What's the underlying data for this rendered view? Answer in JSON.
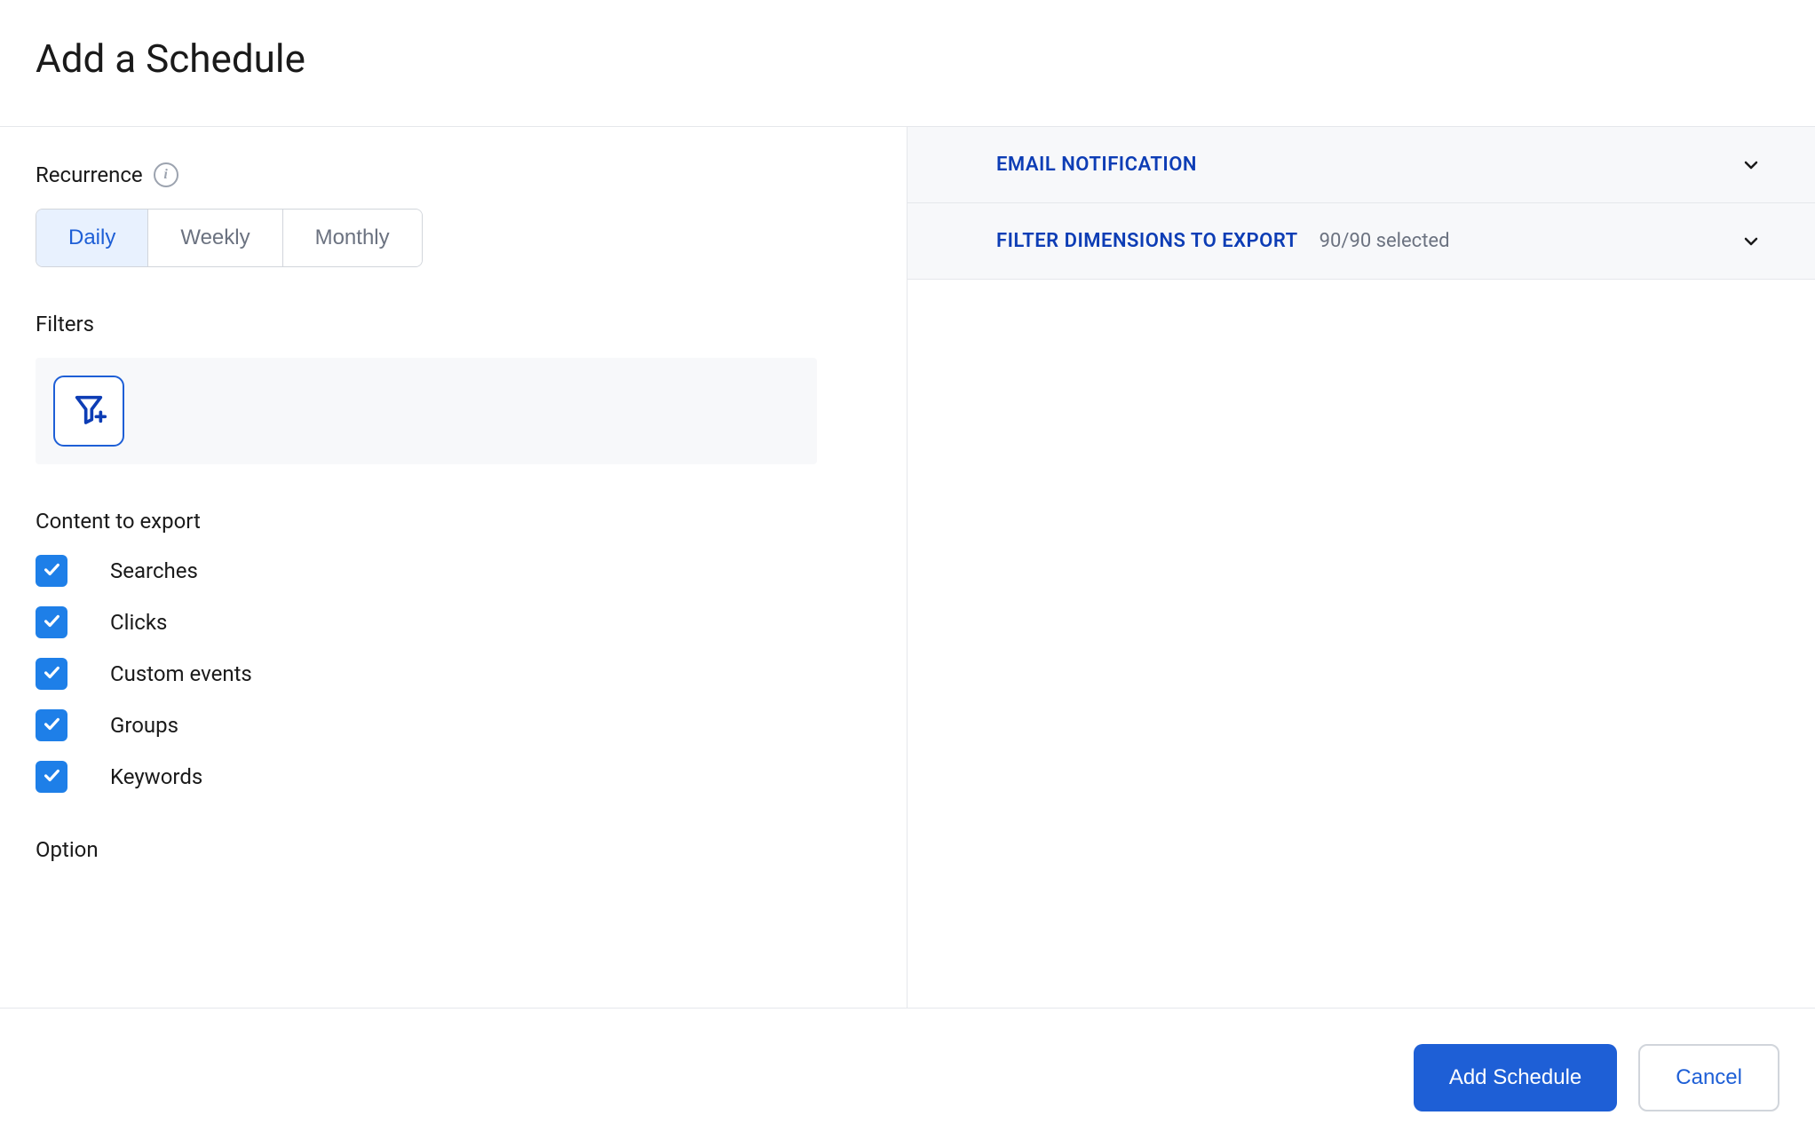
{
  "header": {
    "title": "Add a Schedule"
  },
  "recurrence": {
    "label": "Recurrence",
    "options": {
      "daily": "Daily",
      "weekly": "Weekly",
      "monthly": "Monthly"
    }
  },
  "filters": {
    "label": "Filters"
  },
  "content_to_export": {
    "label": "Content to export",
    "items": [
      {
        "label": "Searches",
        "checked": true
      },
      {
        "label": "Clicks",
        "checked": true
      },
      {
        "label": "Custom events",
        "checked": true
      },
      {
        "label": "Groups",
        "checked": true
      },
      {
        "label": "Keywords",
        "checked": true
      }
    ]
  },
  "option": {
    "label": "Option"
  },
  "accordion": {
    "email_notification": {
      "title": "EMAIL NOTIFICATION"
    },
    "filter_dimensions": {
      "title": "FILTER DIMENSIONS TO EXPORT",
      "subtitle": "90/90 selected"
    }
  },
  "footer": {
    "add_schedule": "Add Schedule",
    "cancel": "Cancel"
  }
}
